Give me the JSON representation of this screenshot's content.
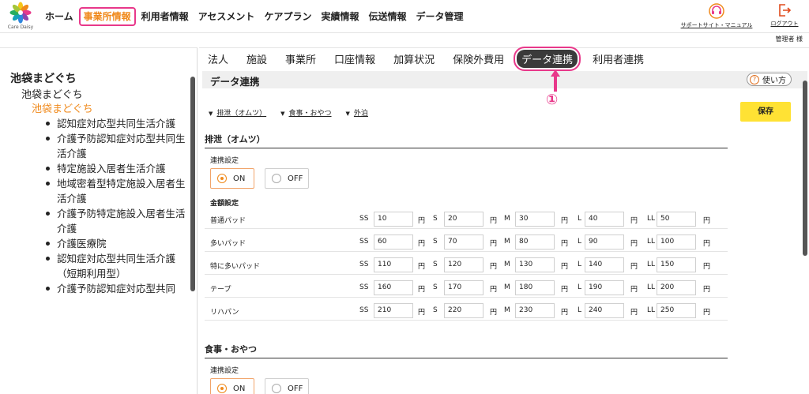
{
  "logo": {
    "text": "Care Daisy"
  },
  "nav": {
    "items": [
      "ホーム",
      "事業所情報",
      "利用者情報",
      "アセスメント",
      "ケアプラン",
      "実績情報",
      "伝送情報",
      "データ管理"
    ],
    "active": "事業所情報"
  },
  "header": {
    "support": "サポートサイト・マニュアル",
    "logout": "ログアウト",
    "user": "管理者 様"
  },
  "tree": {
    "root": "池袋まどぐち",
    "level1": "池袋まどぐち",
    "level2": "池袋まどぐち",
    "services": [
      "認知症対応型共同生活介護",
      "介護予防認知症対応型共同生活介護",
      "特定施設入居者生活介護",
      "地域密着型特定施設入居者生活介護",
      "介護予防特定施設入居者生活介護",
      "介護医療院",
      "認知症対応型共同生活介護（短期利用型）",
      "介護予防認知症対応型共同"
    ]
  },
  "tabs": {
    "items": [
      "法人",
      "施設",
      "事業所",
      "口座情報",
      "加算状況",
      "保険外費用",
      "データ連携",
      "利用者連携"
    ],
    "active": "データ連携"
  },
  "annotation": {
    "number": "①",
    "color": "#e8388a"
  },
  "section": {
    "title": "データ連携",
    "help": "使い方",
    "help_icon": "?"
  },
  "anchors": [
    "排泄（オムツ）",
    "食事・おやつ",
    "外泊"
  ],
  "anchor_icon": "▼",
  "save": "保存",
  "excretion": {
    "heading": "排泄（オムツ）",
    "setting_label": "連携設定",
    "on": "ON",
    "off": "OFF",
    "selected": "ON",
    "amount_label": "金額設定",
    "sizes": [
      "SS",
      "S",
      "M",
      "L",
      "LL"
    ],
    "currency": "円",
    "rows": [
      {
        "label": "普通パッド",
        "values": [
          "10",
          "20",
          "30",
          "40",
          "50"
        ]
      },
      {
        "label": "多いパッド",
        "values": [
          "60",
          "70",
          "80",
          "90",
          "100"
        ]
      },
      {
        "label": "特に多いパッド",
        "values": [
          "110",
          "120",
          "130",
          "140",
          "150"
        ]
      },
      {
        "label": "テープ",
        "values": [
          "160",
          "170",
          "180",
          "190",
          "200"
        ]
      },
      {
        "label": "リハパン",
        "values": [
          "210",
          "220",
          "230",
          "240",
          "250"
        ]
      }
    ]
  },
  "meal": {
    "heading": "食事・おやつ",
    "setting_label": "連携設定",
    "on": "ON",
    "off": "OFF"
  },
  "colors": {
    "accent_orange": "#f08a1c",
    "highlight_pink": "#e8388a",
    "save_yellow": "#ffe234"
  }
}
